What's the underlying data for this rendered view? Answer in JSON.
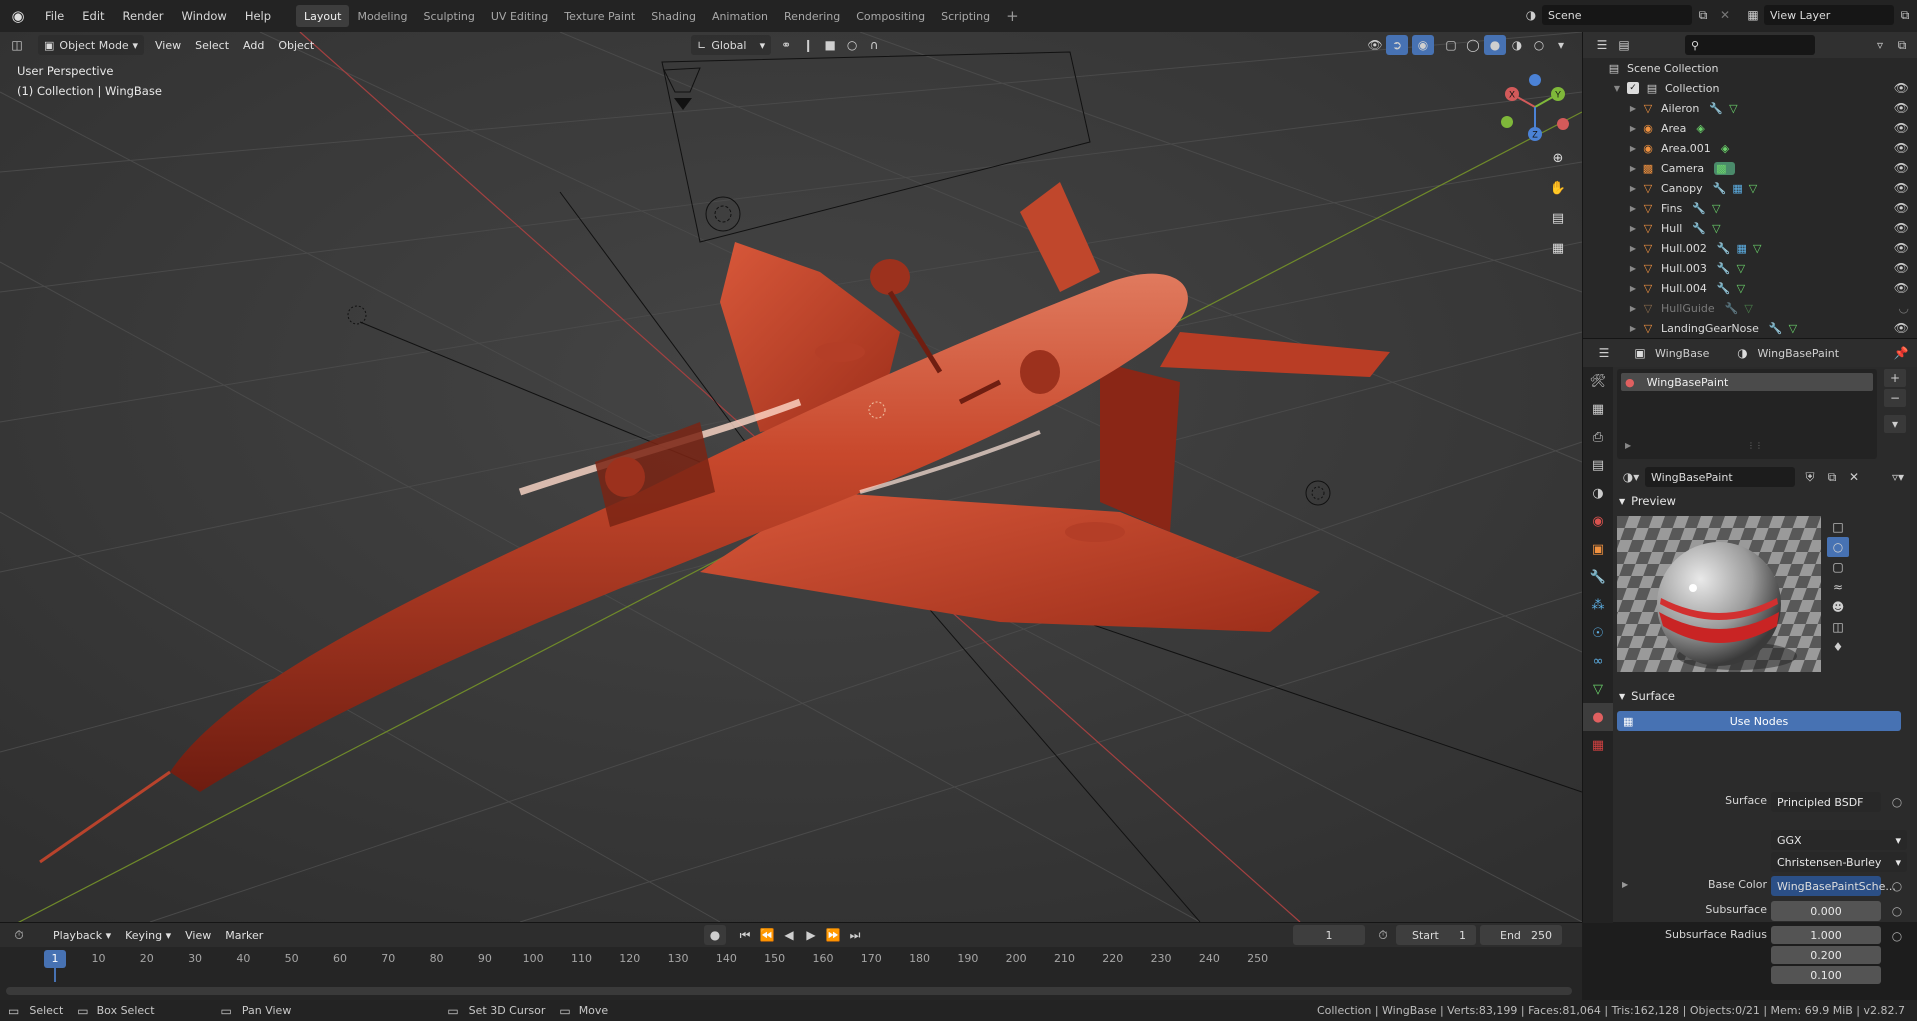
{
  "topbar": {
    "menus": [
      "File",
      "Edit",
      "Render",
      "Window",
      "Help"
    ],
    "workspaces": [
      "Layout",
      "Modeling",
      "Sculpting",
      "UV Editing",
      "Texture Paint",
      "Shading",
      "Animation",
      "Rendering",
      "Compositing",
      "Scripting"
    ],
    "active_workspace": "Layout",
    "scene": "Scene",
    "view_layer": "View Layer"
  },
  "viewport": {
    "mode": "Object Mode",
    "menus": [
      "View",
      "Select",
      "Add",
      "Object"
    ],
    "orientation": "Global",
    "overlay_title": "User Perspective",
    "overlay_subtitle": "(1) Collection | WingBase",
    "gizmo_axes": [
      "X",
      "Y",
      "Z"
    ]
  },
  "outliner": {
    "root": "Scene Collection",
    "collection": "Collection",
    "items": [
      {
        "name": "Aileron",
        "icon": "mesh-icon"
      },
      {
        "name": "Area",
        "icon": "light-icon"
      },
      {
        "name": "Area.001",
        "icon": "light-icon"
      },
      {
        "name": "Camera",
        "icon": "camera-icon"
      },
      {
        "name": "Canopy",
        "icon": "mesh-icon"
      },
      {
        "name": "Fins",
        "icon": "mesh-icon"
      },
      {
        "name": "Hull",
        "icon": "mesh-icon"
      },
      {
        "name": "Hull.002",
        "icon": "mesh-icon"
      },
      {
        "name": "Hull.003",
        "icon": "mesh-icon"
      },
      {
        "name": "Hull.004",
        "icon": "mesh-icon"
      },
      {
        "name": "HullGuide",
        "icon": "mesh-icon",
        "dimmed": true
      },
      {
        "name": "LandingGearNose",
        "icon": "mesh-icon"
      }
    ]
  },
  "properties": {
    "object": "WingBase",
    "material": "WingBasePaint",
    "slot": "WingBasePaint",
    "material_field": "WingBasePaint",
    "preview_label": "Preview",
    "surface_section": "Surface",
    "use_nodes": "Use Nodes",
    "fields": [
      {
        "label": "Surface",
        "value": "Principled BSDF"
      },
      {
        "label": "",
        "value": "GGX"
      },
      {
        "label": "",
        "value": "Christensen-Burley"
      },
      {
        "label": "Base Color",
        "value": "WingBasePaintSche..."
      },
      {
        "label": "Subsurface",
        "value": "0.000"
      },
      {
        "label": "Subsurface Radius",
        "value": "1.000"
      },
      {
        "label": "",
        "value": "0.200"
      },
      {
        "label": "",
        "value": "0.100"
      }
    ]
  },
  "timeline": {
    "menus": [
      "Playback",
      "Keying",
      "View",
      "Marker"
    ],
    "current_frame": "1",
    "start_label": "Start",
    "start": "1",
    "end_label": "End",
    "end": "250",
    "ticks": [
      "1",
      "10",
      "20",
      "30",
      "40",
      "50",
      "60",
      "70",
      "80",
      "90",
      "100",
      "110",
      "120",
      "130",
      "140",
      "150",
      "160",
      "170",
      "180",
      "190",
      "200",
      "210",
      "220",
      "230",
      "240",
      "250"
    ]
  },
  "status": {
    "hints": [
      "Select",
      "Box Select",
      "Pan View",
      "Set 3D Cursor",
      "Move"
    ],
    "stats": "Collection | WingBase | Verts:83,199 | Faces:81,064 | Tris:162,128 | Objects:0/21 | Mem: 69.9 MiB | v2.82.7"
  }
}
